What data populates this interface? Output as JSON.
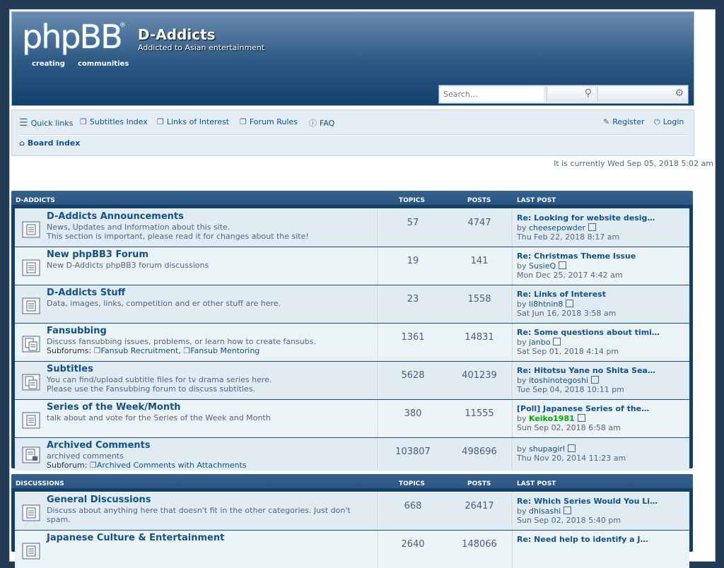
{
  "header": {
    "logo_main": "phpBB",
    "logo_reg": "®",
    "logo_tag1": "creating",
    "logo_tag2": "communities",
    "site_title": "D-Addicts",
    "site_desc": "Addicted to Asian entertainment",
    "search_placeholder": "Search…"
  },
  "nav": {
    "quick_links": "Quick links",
    "subtitles_index": "Subtitles Index",
    "links_of_interest": "Links of Interest",
    "forum_rules": "Forum Rules",
    "faq": "FAQ",
    "register": "Register",
    "login": "Login",
    "board_index": "Board index"
  },
  "time_line": "It is currently Wed Sep 05, 2018 5:02 am",
  "columns": {
    "topics": "TOPICS",
    "posts": "POSTS",
    "last_post": "LAST POST"
  },
  "categories": [
    {
      "name": "D-ADDICTS",
      "forums": [
        {
          "title": "D-Addicts Announcements",
          "desc1": "News, Updates and Information about this site.",
          "desc2": "This section is important, please read it for changes about the site!",
          "topics": "57",
          "posts": "4747",
          "lp_title": "Re: Looking for website desig…",
          "lp_by": "by",
          "lp_user": "cheesepowder",
          "lp_date": "Thu Feb 22, 2018 8:17 am"
        },
        {
          "title": "New phpBB3 Forum",
          "desc1": "New D-Addicts phpBB3 forum discussions",
          "desc2": "",
          "topics": "19",
          "posts": "141",
          "lp_title": "Re: Christmas Theme Issue",
          "lp_by": "by",
          "lp_user": "SusieQ",
          "lp_date": "Mon Dec 25, 2017 4:42 am"
        },
        {
          "title": "D-Addicts Stuff",
          "desc1": "Data, images, links, competition and er other stuff are here.",
          "desc2": "",
          "topics": "23",
          "posts": "1558",
          "lp_title": "Re: Links of Interest",
          "lp_by": "by",
          "lp_user": "li8htnin8",
          "lp_date": "Sat Jun 16, 2018 3:58 am"
        },
        {
          "title": "Fansubbing",
          "desc1": "Discuss fansubbing issues, problems, or learn how to create fansubs.",
          "subforums_label": "Subforums:",
          "subforum1": "Fansub Recruitment,",
          "subforum2": "Fansub Mentoring",
          "topics": "1361",
          "posts": "14831",
          "lp_title": "Re: Some questions about timi…",
          "lp_by": "by",
          "lp_user": "janbo",
          "lp_date": "Sat Sep 01, 2018 4:14 pm"
        },
        {
          "title": "Subtitles",
          "desc1": "You can find/upload subtitle files for tv drama series here.",
          "desc2": "Please use the Fansubbing forum to discuss subtitles.",
          "topics": "5628",
          "posts": "401239",
          "lp_title": "Re: Hitotsu Yane no Shita Sea…",
          "lp_by": "by",
          "lp_user": "itoshinotegoshi",
          "lp_date": "Tue Sep 04, 2018 10:11 pm"
        },
        {
          "title": "Series of the Week/Month",
          "desc1": "talk about and vote for the Series of the Week and Month",
          "desc2": "",
          "topics": "380",
          "posts": "11555",
          "lp_title": "[Poll] Japanese Series of the…",
          "lp_by": "by",
          "lp_user": "Keiko1981",
          "lp_date": "Sun Sep 02, 2018 6:58 am"
        },
        {
          "title": "Archived Comments",
          "desc1": "archived comments",
          "subforums_label": "Subforum:",
          "subforum1": "Archived Comments with Attachments",
          "topics": "103807",
          "posts": "498696",
          "lp_by": "by",
          "lp_user": "shupagirl",
          "lp_date": "Thu Nov 20, 2014 11:23 am"
        }
      ]
    },
    {
      "name": "DISCUSSIONS",
      "forums": [
        {
          "title": "General Discussions",
          "desc1": "Discuss about anything here that doesn't fit in the other categories. Just don't",
          "desc2": "spam.",
          "topics": "668",
          "posts": "26417",
          "lp_title": "Re: Which Series Would You Li…",
          "lp_by": "by",
          "lp_user": "dhisashi",
          "lp_date": "Sun Sep 02, 2018 5:40 pm"
        },
        {
          "title": "Japanese Culture & Entertainment",
          "desc1": "",
          "topics": "2640",
          "posts": "148066",
          "lp_title": "Re: Need help to identify a J…"
        }
      ]
    }
  ]
}
